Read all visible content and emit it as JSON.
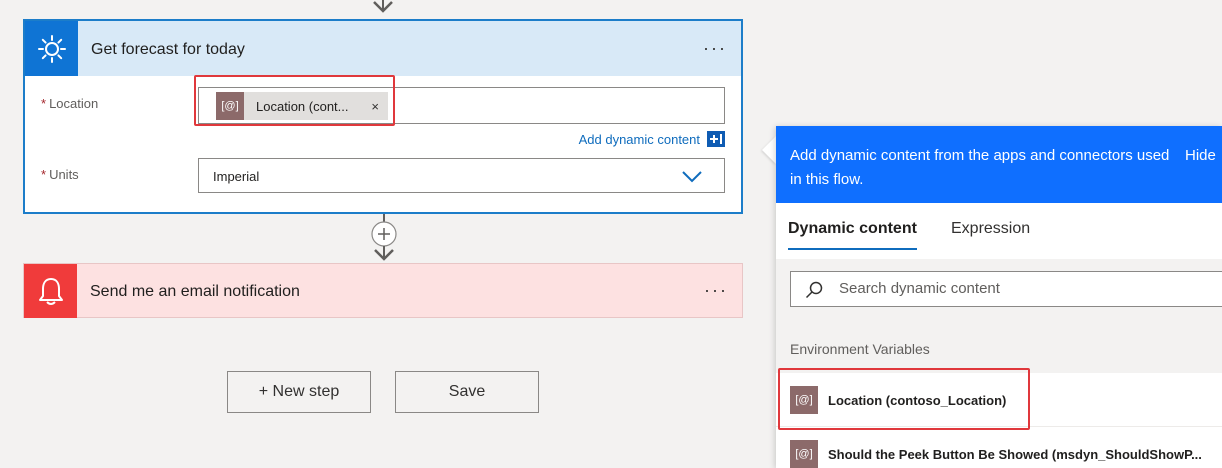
{
  "forecast_card": {
    "title": "Get forecast for today",
    "more": "···",
    "location_label": "Location",
    "location_token": "Location (cont...",
    "token_icon": "[@]",
    "token_close": "×",
    "add_dynamic": "Add dynamic content",
    "units_label": "Units",
    "units_value": "Imperial",
    "required_mark": "*"
  },
  "email_card": {
    "title": "Send me an email notification",
    "more": "···"
  },
  "buttons": {
    "new_step": "+ New step",
    "save": "Save"
  },
  "panel": {
    "description": "Add dynamic content from the apps and connectors used in this flow.",
    "hide": "Hide",
    "tabs": [
      "Dynamic content",
      "Expression"
    ],
    "search_placeholder": "Search dynamic content",
    "section": "Environment Variables",
    "items": [
      {
        "icon": "[@]",
        "label": "Location (contoso_Location)"
      },
      {
        "icon": "[@]",
        "label": "Should the Peek Button Be Showed (msdyn_ShouldShowP..."
      }
    ]
  },
  "colors": {
    "forecast_accent": "#0f74d4",
    "email_accent": "#f03b3b",
    "panel_header": "#0f6fff",
    "highlight": "#e0383c"
  }
}
